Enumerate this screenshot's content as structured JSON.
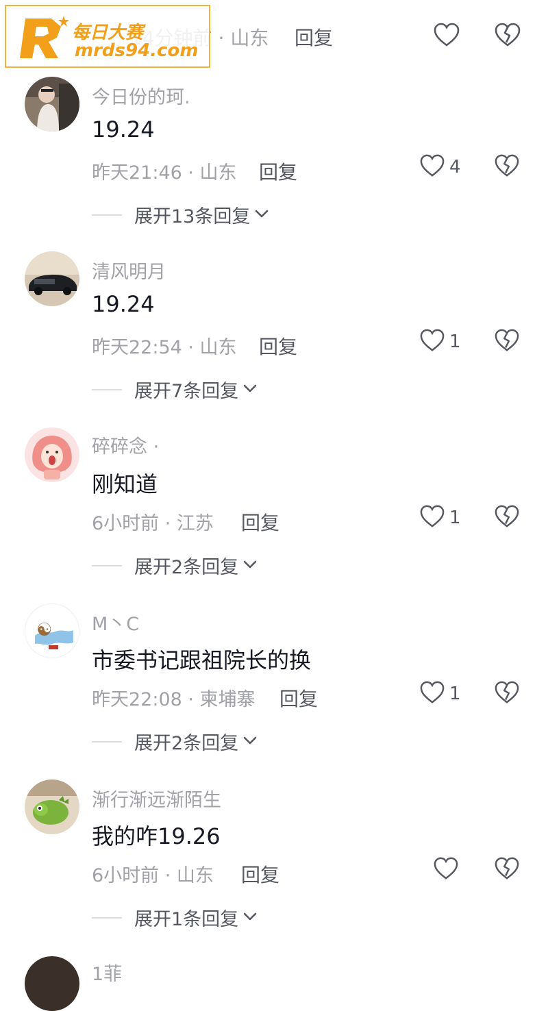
{
  "watermark": {
    "cn": "每日大赛",
    "url": "mrds94.com"
  },
  "top_row": {
    "meta": "14分钟前 · 山东",
    "reply": "回复"
  },
  "comments": [
    {
      "user": "今日份的珂.",
      "text": "19.24",
      "meta": "昨天21:46 · 山东",
      "reply": "回复",
      "likes": "4",
      "expand": "展开13条回复"
    },
    {
      "user": "清风明月",
      "text": "19.24",
      "meta": "昨天22:54 · 山东",
      "reply": "回复",
      "likes": "1",
      "expand": "展开7条回复"
    },
    {
      "user": "碎碎念 ·",
      "text": "刚知道",
      "meta": "6小时前 · 江苏",
      "reply": "回复",
      "likes": "1",
      "expand": "展开2条回复"
    },
    {
      "user": "M丶C",
      "text": "市委书记跟祖院长的换",
      "meta": "昨天22:08 · 柬埔寨",
      "reply": "回复",
      "likes": "1",
      "expand": "展开2条回复"
    },
    {
      "user": "渐行渐远渐陌生",
      "text": "我的咋19.26",
      "meta": "6小时前 · 山东",
      "reply": "回复",
      "likes": "",
      "expand": "展开1条回复"
    }
  ],
  "partial_user": "1菲",
  "colors": {
    "primary_text": "#161823",
    "secondary_text": "#a1a2a7",
    "action_text": "#555760",
    "watermark": "#f2a01b"
  },
  "icons": {
    "like": "heart-outline-icon",
    "dislike": "broken-heart-icon",
    "expand": "chevron-down-icon"
  }
}
